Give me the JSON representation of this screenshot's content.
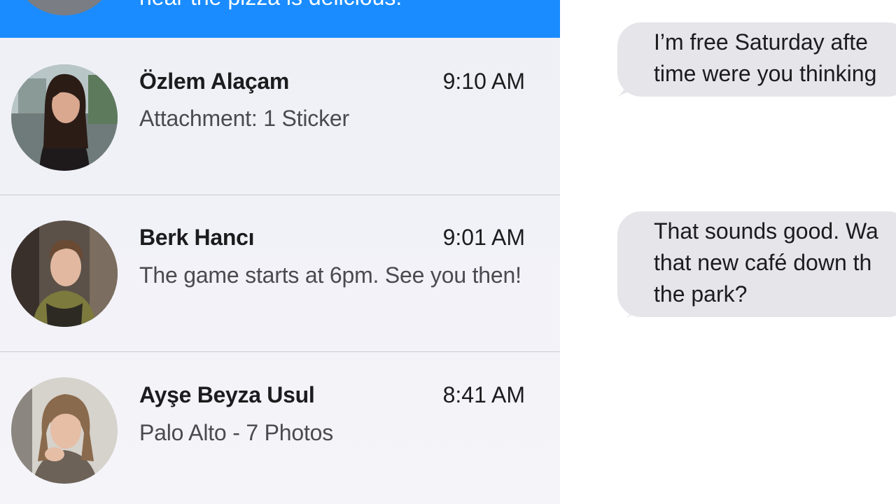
{
  "conversations": [
    {
      "name": "",
      "preview": "hear the pizza is delicious.",
      "time": "",
      "selected": true
    },
    {
      "name": "Özlem Alaçam",
      "time": "9:10 AM",
      "preview": "Attachment: 1 Sticker"
    },
    {
      "name": "Berk Hancı",
      "time": "9:01 AM",
      "preview": "The game starts at 6pm. See you then!"
    },
    {
      "name": "Ayşe Beyza Usul",
      "time": "8:41 AM",
      "preview": "Palo Alto - 7 Photos"
    }
  ],
  "transcript": {
    "messages": [
      {
        "lines": [
          "I’m free Saturday afte",
          "time were you thinking"
        ]
      },
      {
        "lines": [
          "That sounds good. Wa",
          "that new café down th",
          "the park?"
        ]
      }
    ]
  },
  "colors": {
    "selection": "#1a8cff",
    "list_bg": "#eff0f6",
    "bubble_bg": "#e5e5ea",
    "separator": "#c9c9ce"
  }
}
